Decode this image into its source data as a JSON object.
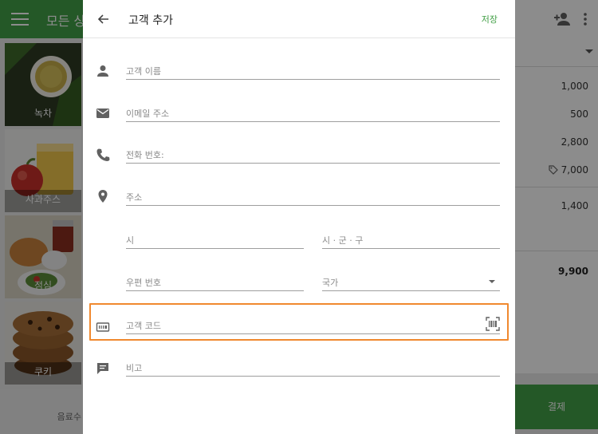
{
  "app": {
    "title": "모든 상",
    "items": [
      {
        "name": "녹차",
        "icon": "green-tea-image"
      },
      {
        "name": "사과주스",
        "icon": "apple-juice-image"
      },
      {
        "name": "점심",
        "icon": "lunch-image"
      },
      {
        "name": "쿠키",
        "icon": "cookie-image"
      }
    ],
    "category_footer": "음료수",
    "ticket_lines": [
      "1,000",
      "500",
      "2,800",
      "7,000",
      "1,400"
    ],
    "ticket_total": "9,900",
    "charge_label": "결제"
  },
  "dialog": {
    "title": "고객 추가",
    "save_label": "저장",
    "fields": {
      "name": "고객 이름",
      "email": "이메일 주소",
      "phone": "전화 번호:",
      "address": "주소",
      "city": "시",
      "region": "시 · 군 · 구",
      "postal": "우편 번호",
      "country": "국가",
      "customer_code": "고객 코드",
      "note": "비고"
    }
  },
  "colors": {
    "accent_green": "#43a047",
    "highlight_orange": "#f0892f"
  }
}
